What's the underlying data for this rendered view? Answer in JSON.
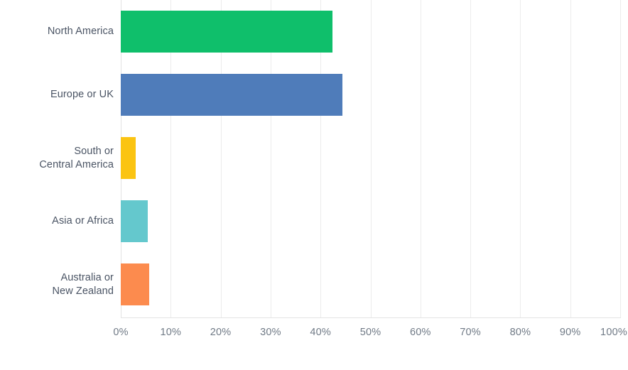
{
  "chart_data": {
    "type": "bar",
    "orientation": "horizontal",
    "title": "",
    "subtitle": "",
    "xlabel": "",
    "ylabel": "",
    "categories": [
      "North America",
      "Europe or UK",
      "South or\nCentral America",
      "Asia or Africa",
      "Australia or\nNew Zealand"
    ],
    "values": [
      42.4,
      44.4,
      3.0,
      5.4,
      5.7
    ],
    "value_unit": "%",
    "xlim": [
      0,
      100
    ],
    "xticks": [
      0,
      10,
      20,
      30,
      40,
      50,
      60,
      70,
      80,
      90,
      100
    ],
    "xtick_labels": [
      "0%",
      "10%",
      "20%",
      "30%",
      "40%",
      "50%",
      "60%",
      "70%",
      "80%",
      "90%",
      "100%"
    ],
    "bar_colors": [
      "#0fbf6b",
      "#4f7cba",
      "#fbc412",
      "#64c8cd",
      "#fc8b4e"
    ],
    "grid": true,
    "grid_axis": "x",
    "grid_color": "#ececec",
    "legend": false,
    "legend_position": "none",
    "background_color": "#ffffff",
    "label_color": "#4a5464",
    "tick_label_color": "#707a86",
    "axis_line_color": "#e4e4e4"
  }
}
